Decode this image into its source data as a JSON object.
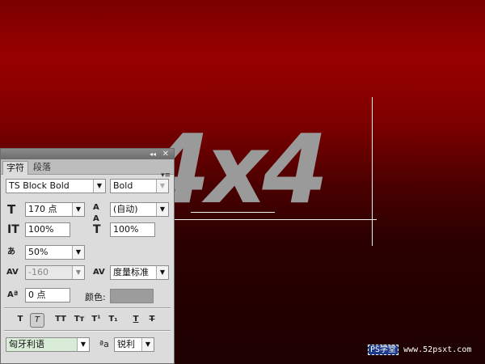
{
  "canvas": {
    "text": "4x4",
    "text_color": "#9a9a9a",
    "background_color": "#990000"
  },
  "panel": {
    "collapse_glyph": "◂◂",
    "close_glyph": "✕",
    "menu_glyph": "▾≡",
    "tabs": [
      {
        "label": "字符",
        "active": true
      },
      {
        "label": "段落",
        "active": false
      }
    ],
    "font_family": "TS Block Bold",
    "font_style": "Bold",
    "font_size": "170 点",
    "leading": "(自动)",
    "vertical_scale": "100%",
    "horizontal_scale": "100%",
    "tsume": "50%",
    "kerning": "-160",
    "tracking": "度量标准",
    "baseline_shift": "0 点",
    "color_label": "颜色:",
    "color_value": "#9c9c9c",
    "type_buttons": [
      {
        "name": "faux-bold",
        "glyph": "T"
      },
      {
        "name": "faux-italic",
        "glyph": "T"
      },
      {
        "name": "all-caps",
        "glyph": "TT"
      },
      {
        "name": "small-caps",
        "glyph": "Tт"
      },
      {
        "name": "superscript",
        "glyph": "T¹"
      },
      {
        "name": "subscript",
        "glyph": "T₁"
      },
      {
        "name": "underline",
        "glyph": "T"
      },
      {
        "name": "strikethrough",
        "glyph": "T"
      }
    ],
    "language": "匈牙利语",
    "anti_alias_icon": "ªa",
    "anti_alias": "锐利"
  },
  "watermark": {
    "brand": "PS学堂",
    "url": "www.52psxt.com"
  }
}
